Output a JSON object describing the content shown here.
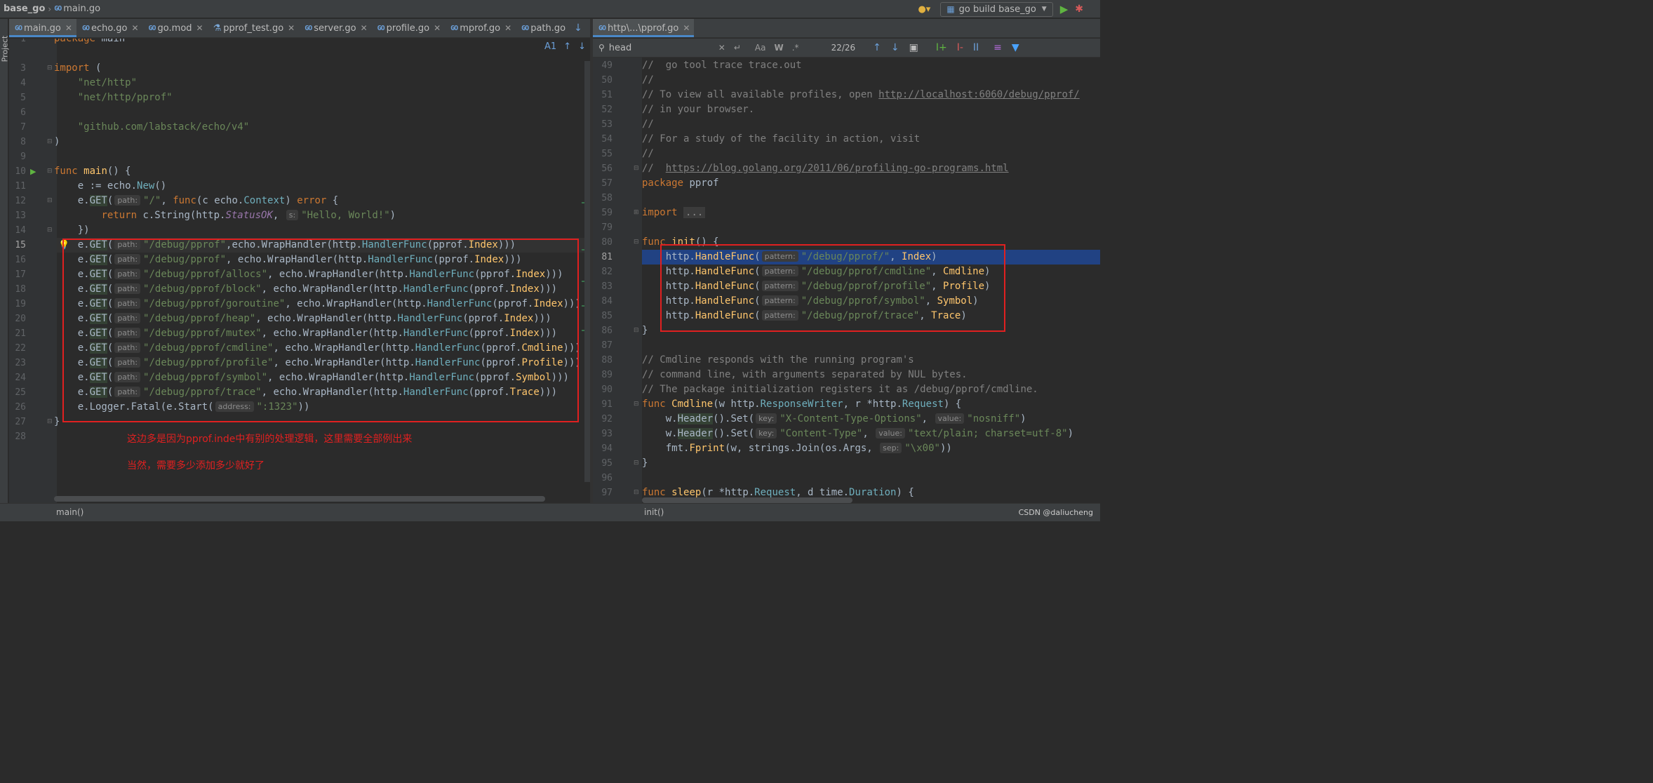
{
  "navbar": {
    "project": "base_go",
    "breadcrumb_file": "main.go",
    "run_config": "go build base_go"
  },
  "toolstrip": {
    "label": "Project"
  },
  "left_tabs": [
    {
      "label": "main.go",
      "active": true,
      "icon": "go-file-icon"
    },
    {
      "label": "echo.go",
      "active": false,
      "icon": "go-file-icon"
    },
    {
      "label": "go.mod",
      "active": false,
      "icon": "go-file-icon"
    },
    {
      "label": "pprof_test.go",
      "active": false,
      "icon": "test-file-icon"
    },
    {
      "label": "server.go",
      "active": false,
      "icon": "go-file-icon"
    },
    {
      "label": "profile.go",
      "active": false,
      "icon": "go-file-icon"
    },
    {
      "label": "mprof.go",
      "active": false,
      "icon": "go-file-icon"
    },
    {
      "label": "path.go",
      "active": false,
      "icon": "go-file-icon"
    }
  ],
  "right_tabs": [
    {
      "label": "http\\...\\pprof.go",
      "active": true,
      "icon": "go-file-icon"
    }
  ],
  "left_editor": {
    "inspection_count": "1",
    "line_numbers": [
      "1",
      "3",
      "4",
      "5",
      "6",
      "7",
      "8",
      "9",
      "10",
      "11",
      "12",
      "13",
      "14",
      "15",
      "16",
      "17",
      "18",
      "19",
      "20",
      "21",
      "22",
      "23",
      "24",
      "25",
      "26",
      "27",
      "28"
    ],
    "top_line": "package main",
    "annotation_1": "这边多是因为pprof.inde中有别的处理逻辑，这里需要全部例出来",
    "annotation_2": "当然，需要多少添加多少就好了",
    "hint_path": "path:",
    "hint_s": "s:",
    "hint_address": "address:"
  },
  "search": {
    "query": "head",
    "count": "22/26",
    "match_case": "Aa",
    "words": "W",
    "regex": ".*"
  },
  "right_editor": {
    "line_numbers": [
      "49",
      "50",
      "51",
      "52",
      "53",
      "54",
      "55",
      "56",
      "57",
      "58",
      "59",
      "79",
      "80",
      "81",
      "82",
      "83",
      "84",
      "85",
      "86",
      "87",
      "88",
      "89",
      "90",
      "91",
      "92",
      "93",
      "94",
      "95",
      "96",
      "97"
    ],
    "hint_pattern": "pattern:",
    "hint_key": "key:",
    "hint_value": "value:",
    "hint_sep": "sep:"
  },
  "statusbar": {
    "left_crumb": "main()",
    "right_crumb": "init()",
    "watermark": "CSDN @daliucheng"
  }
}
